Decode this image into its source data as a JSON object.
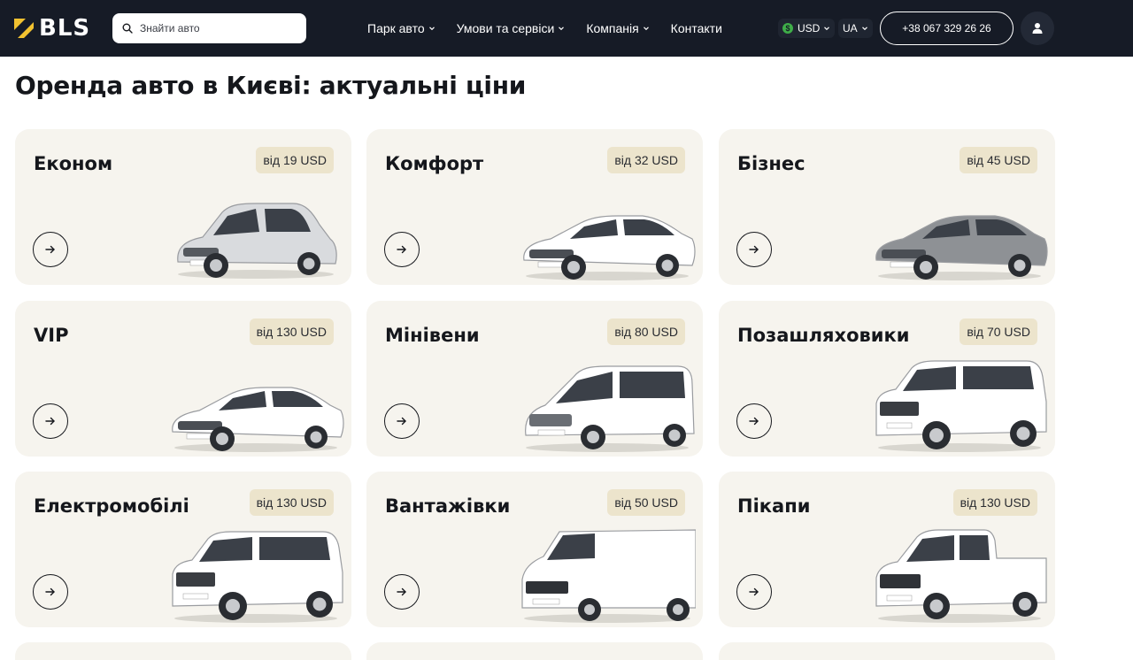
{
  "header": {
    "logo_text": "BLS",
    "search_placeholder": "Знайти авто",
    "nav": [
      {
        "label": "Парк авто"
      },
      {
        "label": "Умови та сервіси"
      },
      {
        "label": "Компанія"
      },
      {
        "label": "Контакти"
      }
    ],
    "currency": "USD",
    "currency_symbol": "$",
    "language": "UA",
    "phone": "+38 067 329 26 26"
  },
  "page": {
    "title": "Оренда авто в Києві: актуальні ціни"
  },
  "categories": [
    {
      "name": "Економ",
      "price": "від 19 USD",
      "car_color": "#d9dbde",
      "body": "hatch"
    },
    {
      "name": "Комфорт",
      "price": "від 32 USD",
      "car_color": "#ffffff",
      "body": "sedan"
    },
    {
      "name": "Бізнес",
      "price": "від 45 USD",
      "car_color": "#8e9195",
      "body": "sedan"
    },
    {
      "name": "VIP",
      "price": "від 130 USD",
      "car_color": "#ffffff",
      "body": "sedan"
    },
    {
      "name": "Мінівени",
      "price": "від 80 USD",
      "car_color": "#ffffff",
      "body": "van"
    },
    {
      "name": "Позашляховики",
      "price": "від 70 USD",
      "car_color": "#ffffff",
      "body": "suv"
    },
    {
      "name": "Електромобілі",
      "price": "від 130 USD",
      "car_color": "#ffffff",
      "body": "suv"
    },
    {
      "name": "Вантажівки",
      "price": "від 50 USD",
      "car_color": "#ffffff",
      "body": "cargo"
    },
    {
      "name": "Пікапи",
      "price": "від 130 USD",
      "car_color": "#ffffff",
      "body": "pickup"
    }
  ],
  "colors": {
    "header_bg": "#161b26",
    "accent_yellow": "#f2c230",
    "card_bg": "#f6f4ee",
    "price_badge_bg": "#ece4cc",
    "currency_green": "#3fae49"
  },
  "icons": {
    "search": "search-icon",
    "chevron": "chevron-down-icon",
    "arrow": "arrow-right-icon",
    "account": "user-icon"
  }
}
